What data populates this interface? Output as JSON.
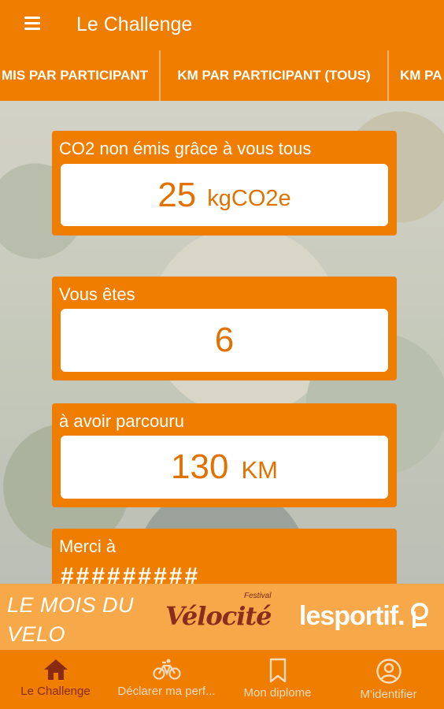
{
  "app": {
    "title": "Le Challenge"
  },
  "tabs": [
    {
      "label": "MIS PAR PARTICIPANT"
    },
    {
      "label": "KM PAR PARTICIPANT (TOUS)"
    },
    {
      "label": "KM PA"
    }
  ],
  "cards": {
    "co2": {
      "label": "CO2 non émis grâce à vous tous",
      "value": "25",
      "unit": "kgCO2e"
    },
    "rank": {
      "label": "Vous êtes",
      "value": "6"
    },
    "distance": {
      "label": "à avoir parcouru",
      "value": "130",
      "unit": "KM"
    },
    "thanks": {
      "label": "Merci à",
      "value": "#########"
    }
  },
  "banner": {
    "line1": "LE MOIS DU",
    "line2": "VELO",
    "festival": "Festival",
    "velocite": "Vélocité",
    "sportif": "lesportif."
  },
  "nav": [
    {
      "label": "Le Challenge"
    },
    {
      "label": "Déclarer ma perf..."
    },
    {
      "label": "Mon diplome"
    },
    {
      "label": "M'identifier"
    }
  ],
  "colors": {
    "primary": "#ef7d00",
    "banner": "#f7a94a",
    "active_nav": "#8a2a10"
  }
}
